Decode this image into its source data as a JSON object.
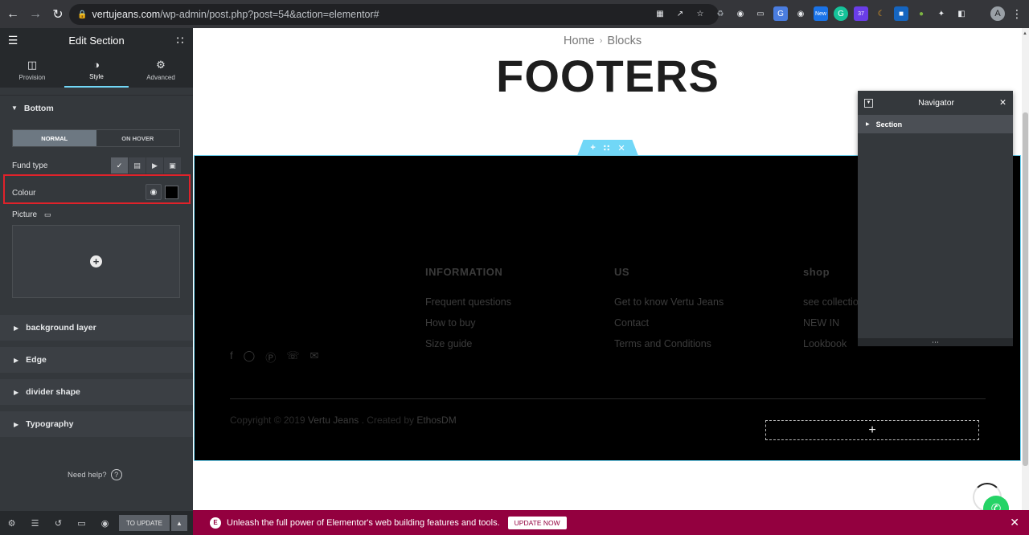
{
  "browser": {
    "url_host": "vertujeans.com",
    "url_path": "/wp-admin/post.php?post=54&action=elementor#",
    "avatar_letter": "A",
    "ext_badge_new": "New",
    "ext_badge_count": "37"
  },
  "panel": {
    "title": "Edit Section",
    "tabs": [
      {
        "label": "Provision",
        "icon": "layout-icon"
      },
      {
        "label": "Style",
        "icon": "half-circle-icon"
      },
      {
        "label": "Advanced",
        "icon": "gear-icon"
      }
    ],
    "section_title": "Bottom",
    "state_tabs": [
      "NORMAL",
      "ON HOVER"
    ],
    "fund_type_label": "Fund type",
    "colour_label": "Colour",
    "colour_value": "#000000",
    "picture_label": "Picture",
    "accordions": [
      "background layer",
      "Edge",
      "divider shape",
      "Typography"
    ],
    "help_text": "Need help?",
    "update_label": "TO UPDATE"
  },
  "page": {
    "breadcrumb": [
      "Home",
      "Blocks"
    ],
    "title": "FOOTERS"
  },
  "footer": {
    "columns": [
      {
        "heading": "INFORMATION",
        "links": [
          "Frequent questions",
          "How to buy",
          "Size guide"
        ]
      },
      {
        "heading": "US",
        "links": [
          "Get to know Vertu Jeans",
          "Contact",
          "Terms and Conditions"
        ]
      },
      {
        "heading": "shop",
        "links": [
          "see collection",
          "NEW IN",
          "Lookbook"
        ]
      }
    ],
    "copyright_prefix": "Copyright © 2019",
    "brand": "Vertu Jeans",
    "created_by": ". Created by",
    "agency": "EthosDM"
  },
  "navigator": {
    "title": "Navigator",
    "item": "Section"
  },
  "promo": {
    "text": "Unleash the full power of Elementor's web building features and tools.",
    "button": "UPDATE NOW"
  },
  "colors": {
    "accent": "#71d7f7",
    "panel_bg": "#34383c",
    "promo_bg": "#93003f",
    "highlight_border": "#e0222a"
  }
}
